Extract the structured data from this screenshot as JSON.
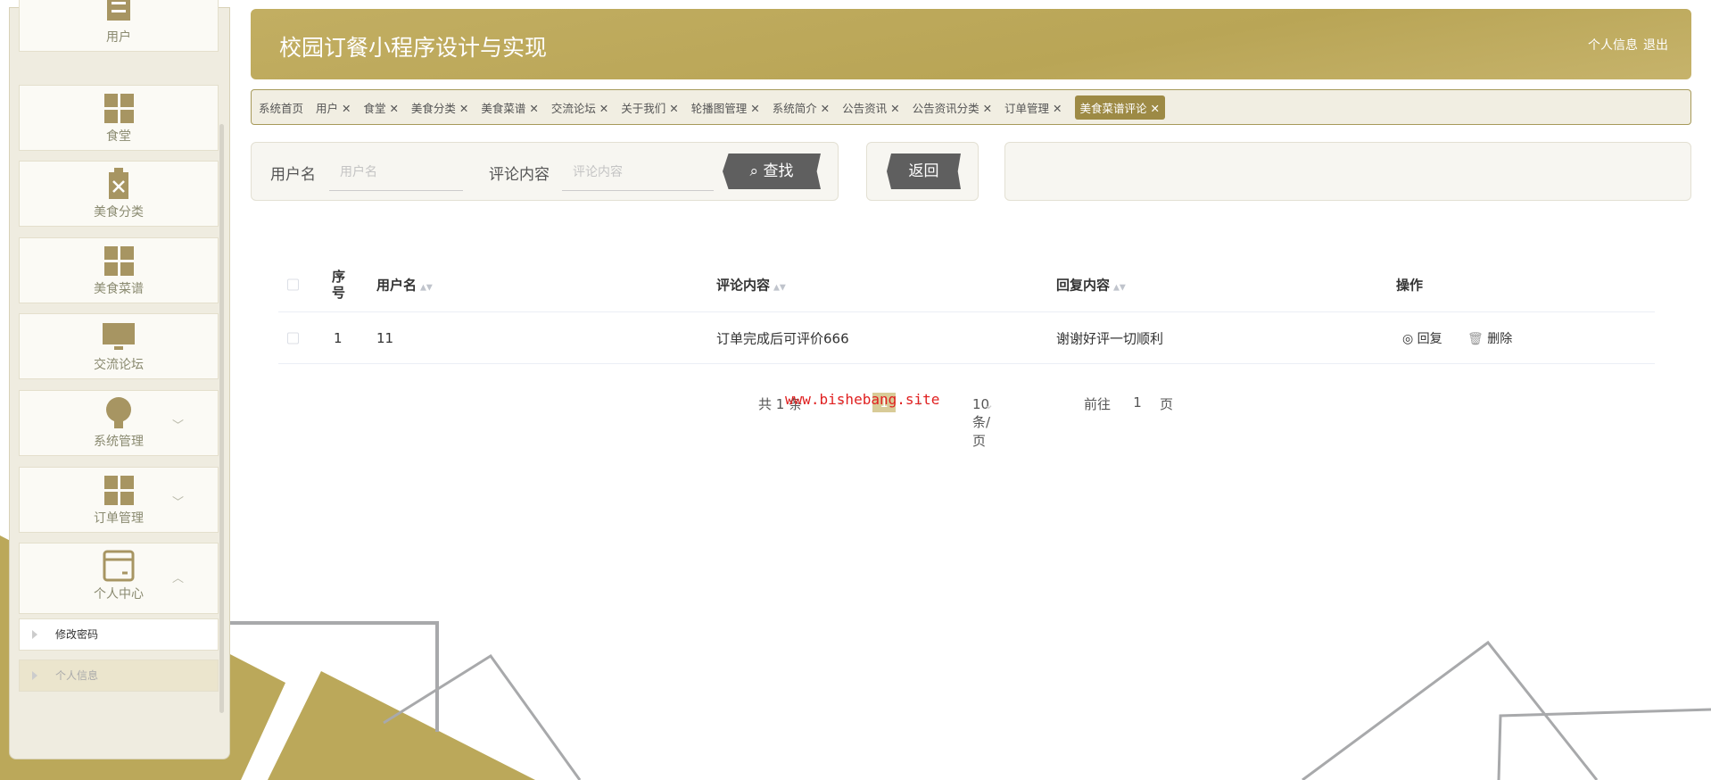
{
  "colors": {
    "accent": "#bba85a",
    "active_tab": "#9d8a45"
  },
  "sidebar": {
    "items": [
      {
        "label": "用户",
        "icon": "list-icon"
      },
      {
        "label": "食堂",
        "icon": "grid-icon"
      },
      {
        "label": "美食分类",
        "icon": "clipboard-x-icon"
      },
      {
        "label": "美食菜谱",
        "icon": "grid-icon"
      },
      {
        "label": "交流论坛",
        "icon": "monitor-icon"
      },
      {
        "label": "系统管理",
        "icon": "bulb-icon"
      },
      {
        "label": "订单管理",
        "icon": "grid-icon"
      },
      {
        "label": "个人中心",
        "icon": "card-icon"
      }
    ],
    "subitems": [
      {
        "label": "修改密码"
      },
      {
        "label": "个人信息"
      }
    ]
  },
  "header": {
    "title": "校园订餐小程序设计与实现",
    "profile": "个人信息",
    "logout": "退出"
  },
  "tabs": [
    "系统首页",
    "用户 ✕",
    "食堂 ✕",
    "美食分类 ✕",
    "美食菜谱 ✕",
    "交流论坛 ✕",
    "关于我们 ✕",
    "轮播图管理 ✕",
    "系统简介 ✕",
    "公告资讯 ✕",
    "公告资讯分类 ✕",
    "订单管理 ✕",
    "美食菜谱评论 ✕"
  ],
  "search": {
    "username_label": "用户名",
    "username_placeholder": "用户名",
    "comment_label": "评论内容",
    "comment_placeholder": "评论内容",
    "search_button": "查找",
    "back_button": "返回"
  },
  "table": {
    "headers": [
      "序号",
      "用户名",
      "评论内容",
      "回复内容",
      "操作"
    ],
    "rows": [
      {
        "index": "1",
        "username": "11",
        "comment": "订单完成后可评价666",
        "reply": "谢谢好评一切顺利",
        "reply_action": "回复",
        "delete_action": "删除"
      }
    ]
  },
  "pager": {
    "total": "共 1 条",
    "page": "1",
    "page_size": "10条/页",
    "goto": "前往",
    "goto_value": "1",
    "page_unit": "页"
  },
  "watermark": "www.bishebang.site"
}
